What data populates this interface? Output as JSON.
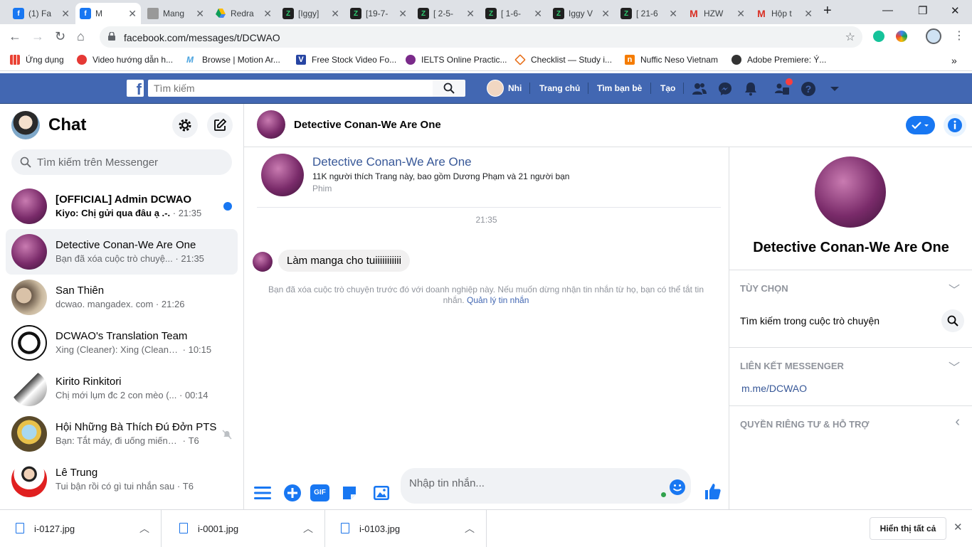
{
  "browser": {
    "tabs": [
      {
        "title": "(1) Fa",
        "icon": "facebook-icon"
      },
      {
        "title": "M",
        "icon": "facebook-icon"
      },
      {
        "title": "Mang",
        "icon": "mangadex-icon"
      },
      {
        "title": "Redra",
        "icon": "google-drive-icon"
      },
      {
        "title": "[Iggy]",
        "icon": "doc-icon"
      },
      {
        "title": "[19-7-",
        "icon": "doc-icon"
      },
      {
        "title": "[ 2-5-",
        "icon": "doc-icon"
      },
      {
        "title": "[ 1-6-",
        "icon": "doc-icon"
      },
      {
        "title": "Iggy V",
        "icon": "doc-icon"
      },
      {
        "title": "[ 21-6",
        "icon": "doc-icon"
      },
      {
        "title": "HZW",
        "icon": "gmail-icon"
      },
      {
        "title": "Hộp t",
        "icon": "gmail-icon"
      }
    ],
    "url": "facebook.com/messages/t/DCWAO",
    "bookmarks": [
      "Ứng dụng",
      "Video hướng dẫn h...",
      "Browse | Motion Ar...",
      "Free Stock Video Fo...",
      "IELTS Online Practic...",
      "Checklist — Study i...",
      "Nuffic Neso Vietnam",
      "Adobe Premiere: Ý..."
    ],
    "more_bookmarks": "»"
  },
  "fb_header": {
    "logo": "f",
    "search_placeholder": "Tìm kiếm",
    "user_name": "Nhi",
    "nav": [
      "Trang chủ",
      "Tìm bạn bè",
      "Tạo"
    ]
  },
  "sidebar": {
    "title": "Chat",
    "search_placeholder": "Tìm kiếm trên Messenger",
    "conversations": [
      {
        "name": "[OFFICIAL] Admin DCWAO",
        "preview": "Kiyo: Chị gửi qua đâu ạ .-.",
        "time": "21:35",
        "unread": true
      },
      {
        "name": "Detective Conan-We Are One",
        "preview": "Bạn đã xóa cuộc trò chuyệ...",
        "time": "21:35",
        "selected": true
      },
      {
        "name": "San Thiên",
        "preview": "dcwao. mangadex. com",
        "time": "21:26"
      },
      {
        "name": "DCWAO's Translation Team",
        "preview": "Xing (Cleaner): Xing (Cleane...",
        "time": "10:15"
      },
      {
        "name": "Kirito Rinkitori",
        "preview": "Chị mới lụm đc 2 con mèo (...",
        "time": "00:14"
      },
      {
        "name": "Hội Những Bà Thích Đú Đởn PTS",
        "preview": "Bạn: Tắt máy, đi uống miếng n...",
        "time": "T6",
        "muted": true
      },
      {
        "name": "Lê Trung",
        "preview": "Tui bận rồi có gì tui nhắn sau",
        "time": "T6"
      }
    ],
    "separator": "·"
  },
  "conversation": {
    "title": "Detective Conan-We Are One",
    "page_card": {
      "name": "Detective Conan-We Are One",
      "likes": "11K người thích Trang này, bao gồm Dương Phạm và 21 người bạn",
      "category": "Phim"
    },
    "timestamp": "21:35",
    "message": "Làm manga cho tuiiiiiiiiiii",
    "notice": "Bạn đã xóa cuộc trò chuyện trước đó với doanh nghiệp này. Nếu muốn dừng nhận tin nhắn từ họ, bạn có thể tắt tin nhắn.",
    "notice_link": "Quản lý tin nhắn",
    "input_placeholder": "Nhập tin nhắn...",
    "gif_label": "GIF"
  },
  "right_panel": {
    "name": "Detective Conan-We Are One",
    "sections": [
      {
        "header": "TÙY CHỌN",
        "item": "Tìm kiếm trong cuộc trò chuyện"
      },
      {
        "header": "LIÊN KẾT MESSENGER",
        "item": "m.me/DCWAO"
      },
      {
        "header": "QUYỀN RIÊNG TƯ & HỖ TRỢ"
      }
    ]
  },
  "downloads": {
    "files": [
      "i-0127.jpg",
      "i-0001.jpg",
      "i-0103.jpg"
    ],
    "show_all": "Hiển thị tất cả"
  },
  "colors": {
    "fb_blue": "#4267b2",
    "messenger_blue": "#1877f2",
    "link": "#385898"
  }
}
